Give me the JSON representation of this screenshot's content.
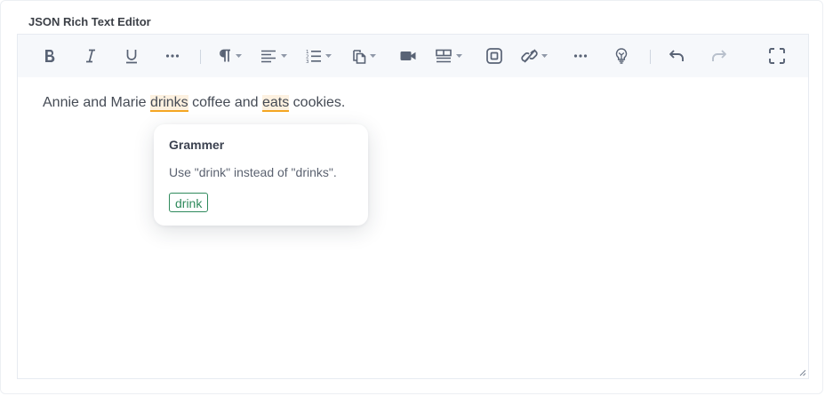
{
  "editor": {
    "title": "JSON Rich Text Editor"
  },
  "toolbar": {
    "icons": [
      "bold-icon",
      "italic-icon",
      "underline-icon",
      "more-format-icon",
      "paragraph-icon",
      "align-icon",
      "ordered-list-icon",
      "paste-icon",
      "video-icon",
      "table-icon",
      "embed-icon",
      "link-icon",
      "more-insert-icon",
      "ai-icon",
      "undo-icon",
      "redo-icon",
      "fullscreen-icon"
    ]
  },
  "content": {
    "segments": [
      {
        "text": "Annie and Marie ",
        "flagged": false
      },
      {
        "text": "drinks",
        "flagged": true
      },
      {
        "text": " coffee and ",
        "flagged": false
      },
      {
        "text": "eats",
        "flagged": true
      },
      {
        "text": " cookies.",
        "flagged": false
      }
    ]
  },
  "popup": {
    "title": "Grammer",
    "message": "Use \"drink\" instead of \"drinks\".",
    "suggestion": "drink"
  },
  "colors": {
    "flag_underline": "#f5a623",
    "flag_background": "#fdf1e0",
    "suggestion": "#2f8a5c",
    "icon": "#596375",
    "icon_disabled": "#b8c0cc",
    "toolbar_bg": "#f6f8fb"
  }
}
